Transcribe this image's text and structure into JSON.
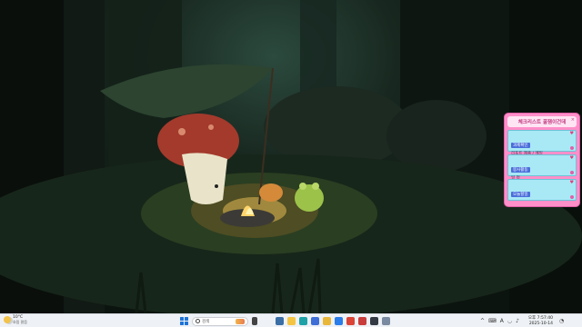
{
  "widget": {
    "title": "체크리스트 꿀잼이건데",
    "notes": [
      {
        "tag": "과제확인",
        "text": "리포트 제출 / 메일"
      },
      {
        "tag": "봉사활동",
        "text": "일 정"
      },
      {
        "tag": "오늘할일",
        "text": ""
      }
    ]
  },
  "taskbar": {
    "weather": {
      "temp": "10°C",
      "desc": "흐림 맑음"
    },
    "search": {
      "placeholder": "검색"
    },
    "apps": [
      {
        "name": "explorer",
        "color": "#3a6ea5"
      },
      {
        "name": "files",
        "color": "#f4c542"
      },
      {
        "name": "edge",
        "color": "#1fa1a8"
      },
      {
        "name": "store",
        "color": "#3f6fd6"
      },
      {
        "name": "folder",
        "color": "#e8b73a"
      },
      {
        "name": "mail",
        "color": "#2b7de9"
      },
      {
        "name": "chrome",
        "color": "#db4437"
      },
      {
        "name": "app-red",
        "color": "#c93c3c"
      },
      {
        "name": "app-dark",
        "color": "#333a44"
      },
      {
        "name": "app-light",
        "color": "#7a8aa0"
      }
    ],
    "tray_icons": [
      "chevron-up-icon",
      "keyboard-icon",
      "ime-icon",
      "wifi-icon",
      "speaker-icon"
    ],
    "tray_labels": [
      "^",
      "⌨",
      "A",
      "◡",
      "♪"
    ],
    "clock": {
      "time": "오후 7:57:40",
      "date": "2025-10-14"
    }
  }
}
